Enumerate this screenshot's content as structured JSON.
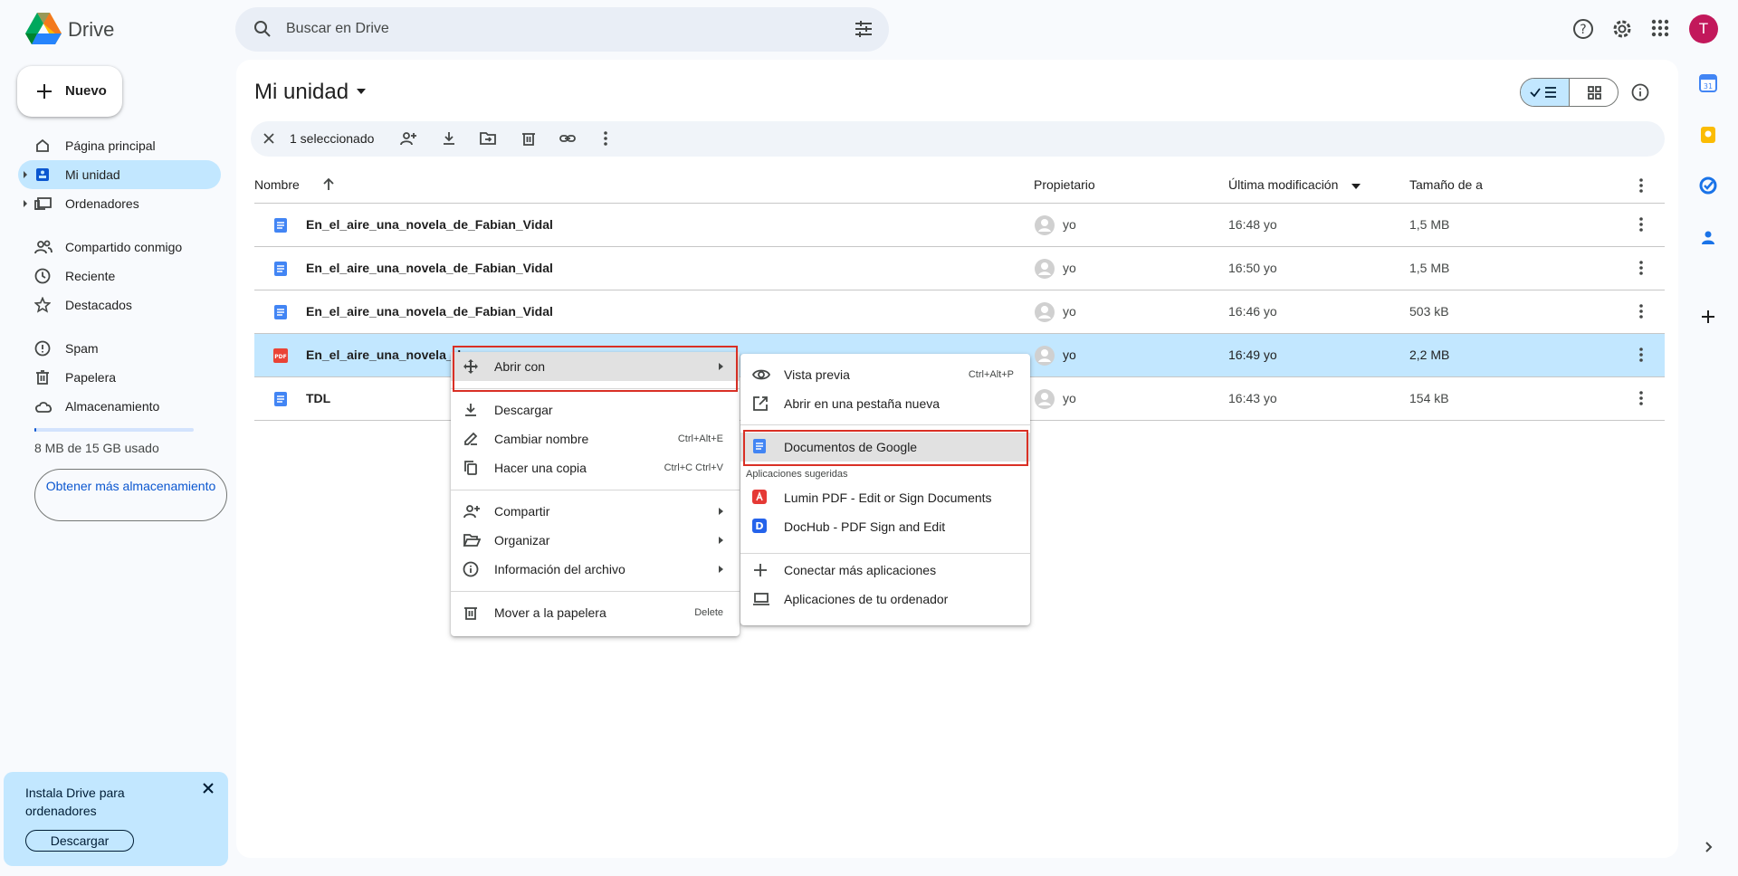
{
  "app": {
    "name": "Drive"
  },
  "search": {
    "placeholder": "Buscar en Drive"
  },
  "user": {
    "initial": "T"
  },
  "sidebar": {
    "new_label": "Nuevo",
    "items": [
      {
        "label": "Página principal"
      },
      {
        "label": "Mi unidad"
      },
      {
        "label": "Ordenadores"
      },
      {
        "label": "Compartido conmigo"
      },
      {
        "label": "Reciente"
      },
      {
        "label": "Destacados"
      },
      {
        "label": "Spam"
      },
      {
        "label": "Papelera"
      },
      {
        "label": "Almacenamiento"
      }
    ],
    "storage_used_fraction": 0.0005,
    "storage_text": "8 MB de 15 GB usado",
    "more_storage": "Obtener más almacenamiento",
    "install": {
      "text": "Instala Drive para ordenadores",
      "download": "Descargar"
    }
  },
  "main": {
    "title": "Mi unidad",
    "selection": {
      "count_label": "1 seleccionado"
    },
    "columns": {
      "name": "Nombre",
      "owner": "Propietario",
      "modified": "Última modificación",
      "size": "Tamaño de a"
    },
    "rows": [
      {
        "name": "En_el_aire_una_novela_de_Fabian_Vidal",
        "type": "doc",
        "owner": "yo",
        "modified": "16:48 yo",
        "size": "1,5 MB",
        "selected": false
      },
      {
        "name": "En_el_aire_una_novela_de_Fabian_Vidal",
        "type": "doc",
        "owner": "yo",
        "modified": "16:50 yo",
        "size": "1,5 MB",
        "selected": false
      },
      {
        "name": "En_el_aire_una_novela_de_Fabian_Vidal",
        "type": "doc",
        "owner": "yo",
        "modified": "16:46 yo",
        "size": "503 kB",
        "selected": false
      },
      {
        "name": "En_el_aire_una_novela_d",
        "type": "pdf",
        "owner": "yo",
        "modified": "16:49 yo",
        "size": "2,2 MB",
        "selected": true
      },
      {
        "name": "TDL",
        "type": "doc",
        "owner": "yo",
        "modified": "16:43 yo",
        "size": "154 kB",
        "selected": false
      }
    ]
  },
  "context_menu": {
    "items": [
      {
        "label": "Abrir con",
        "shortcut": ""
      },
      {
        "label": "Descargar",
        "shortcut": ""
      },
      {
        "label": "Cambiar nombre",
        "shortcut": "Ctrl+Alt+E"
      },
      {
        "label": "Hacer una copia",
        "shortcut": "Ctrl+C Ctrl+V"
      },
      {
        "label": "Compartir",
        "shortcut": ""
      },
      {
        "label": "Organizar",
        "shortcut": ""
      },
      {
        "label": "Información del archivo",
        "shortcut": ""
      },
      {
        "label": "Mover a la papelera",
        "shortcut": "Delete"
      }
    ]
  },
  "submenu": {
    "preview": {
      "label": "Vista previa",
      "shortcut": "Ctrl+Alt+P"
    },
    "new_tab": {
      "label": "Abrir en una pestaña nueva"
    },
    "google_docs": {
      "label": "Documentos de Google"
    },
    "suggested_header": "Aplicaciones sugeridas",
    "lumin": {
      "label": "Lumin PDF - Edit or Sign Documents"
    },
    "dochub": {
      "label": "DocHub - PDF Sign and Edit"
    },
    "connect": {
      "label": "Conectar más aplicaciones"
    },
    "desktop": {
      "label": "Aplicaciones de tu ordenador"
    }
  },
  "colors": {
    "accent": "#0b57d0",
    "selected": "#c2e7ff",
    "highlight_box": "#d93025",
    "doc_blue": "#4285f4",
    "pdf_red": "#ea4335"
  }
}
